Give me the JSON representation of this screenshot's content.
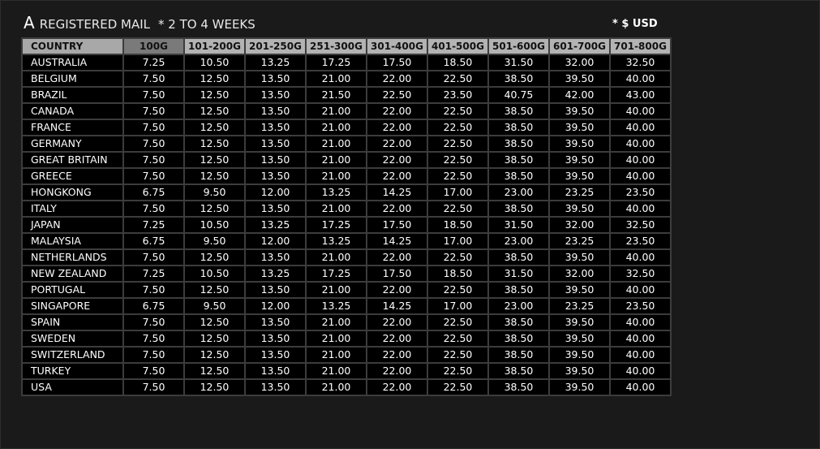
{
  "header": {
    "letter": "A",
    "title": "REGISTERED MAIL",
    "note": "* 2 TO 4 WEEKS",
    "currency": "* $ USD"
  },
  "table": {
    "columns": [
      "COUNTRY",
      "100G",
      "101-200G",
      "201-250G",
      "251-300G",
      "301-400G",
      "401-500G",
      "501-600G",
      "601-700G",
      "701-800G"
    ],
    "rows": [
      {
        "country": "AUSTRALIA",
        "values": [
          "7.25",
          "10.50",
          "13.25",
          "17.25",
          "17.50",
          "18.50",
          "31.50",
          "32.00",
          "32.50"
        ]
      },
      {
        "country": "BELGIUM",
        "values": [
          "7.50",
          "12.50",
          "13.50",
          "21.00",
          "22.00",
          "22.50",
          "38.50",
          "39.50",
          "40.00"
        ]
      },
      {
        "country": "BRAZIL",
        "values": [
          "7.50",
          "12.50",
          "13.50",
          "21.50",
          "22.50",
          "23.50",
          "40.75",
          "42.00",
          "43.00"
        ]
      },
      {
        "country": "CANADA",
        "values": [
          "7.50",
          "12.50",
          "13.50",
          "21.00",
          "22.00",
          "22.50",
          "38.50",
          "39.50",
          "40.00"
        ]
      },
      {
        "country": "FRANCE",
        "values": [
          "7.50",
          "12.50",
          "13.50",
          "21.00",
          "22.00",
          "22.50",
          "38.50",
          "39.50",
          "40.00"
        ]
      },
      {
        "country": "GERMANY",
        "values": [
          "7.50",
          "12.50",
          "13.50",
          "21.00",
          "22.00",
          "22.50",
          "38.50",
          "39.50",
          "40.00"
        ]
      },
      {
        "country": "GREAT BRITAIN",
        "values": [
          "7.50",
          "12.50",
          "13.50",
          "21.00",
          "22.00",
          "22.50",
          "38.50",
          "39.50",
          "40.00"
        ]
      },
      {
        "country": "GREECE",
        "values": [
          "7.50",
          "12.50",
          "13.50",
          "21.00",
          "22.00",
          "22.50",
          "38.50",
          "39.50",
          "40.00"
        ]
      },
      {
        "country": "HONGKONG",
        "values": [
          "6.75",
          "9.50",
          "12.00",
          "13.25",
          "14.25",
          "17.00",
          "23.00",
          "23.25",
          "23.50"
        ]
      },
      {
        "country": "ITALY",
        "values": [
          "7.50",
          "12.50",
          "13.50",
          "21.00",
          "22.00",
          "22.50",
          "38.50",
          "39.50",
          "40.00"
        ]
      },
      {
        "country": "JAPAN",
        "values": [
          "7.25",
          "10.50",
          "13.25",
          "17.25",
          "17.50",
          "18.50",
          "31.50",
          "32.00",
          "32.50"
        ]
      },
      {
        "country": "MALAYSIA",
        "values": [
          "6.75",
          "9.50",
          "12.00",
          "13.25",
          "14.25",
          "17.00",
          "23.00",
          "23.25",
          "23.50"
        ]
      },
      {
        "country": "NETHERLANDS",
        "values": [
          "7.50",
          "12.50",
          "13.50",
          "21.00",
          "22.00",
          "22.50",
          "38.50",
          "39.50",
          "40.00"
        ]
      },
      {
        "country": "NEW ZEALAND",
        "values": [
          "7.25",
          "10.50",
          "13.25",
          "17.25",
          "17.50",
          "18.50",
          "31.50",
          "32.00",
          "32.50"
        ]
      },
      {
        "country": "PORTUGAL",
        "values": [
          "7.50",
          "12.50",
          "13.50",
          "21.00",
          "22.00",
          "22.50",
          "38.50",
          "39.50",
          "40.00"
        ]
      },
      {
        "country": "SINGAPORE",
        "values": [
          "6.75",
          "9.50",
          "12.00",
          "13.25",
          "14.25",
          "17.00",
          "23.00",
          "23.25",
          "23.50"
        ]
      },
      {
        "country": "SPAIN",
        "values": [
          "7.50",
          "12.50",
          "13.50",
          "21.00",
          "22.00",
          "22.50",
          "38.50",
          "39.50",
          "40.00"
        ]
      },
      {
        "country": "SWEDEN",
        "values": [
          "7.50",
          "12.50",
          "13.50",
          "21.00",
          "22.00",
          "22.50",
          "38.50",
          "39.50",
          "40.00"
        ]
      },
      {
        "country": "SWITZERLAND",
        "values": [
          "7.50",
          "12.50",
          "13.50",
          "21.00",
          "22.00",
          "22.50",
          "38.50",
          "39.50",
          "40.00"
        ]
      },
      {
        "country": "TURKEY",
        "values": [
          "7.50",
          "12.50",
          "13.50",
          "21.00",
          "22.00",
          "22.50",
          "38.50",
          "39.50",
          "40.00"
        ]
      },
      {
        "country": "USA",
        "values": [
          "7.50",
          "12.50",
          "13.50",
          "21.00",
          "22.00",
          "22.50",
          "38.50",
          "39.50",
          "40.00"
        ]
      }
    ]
  },
  "colors": {
    "page_background": "#1a1a1a",
    "cell_background": "#000000",
    "header_background": "#b3b3b3",
    "grid_line": "#3c3c3c"
  }
}
